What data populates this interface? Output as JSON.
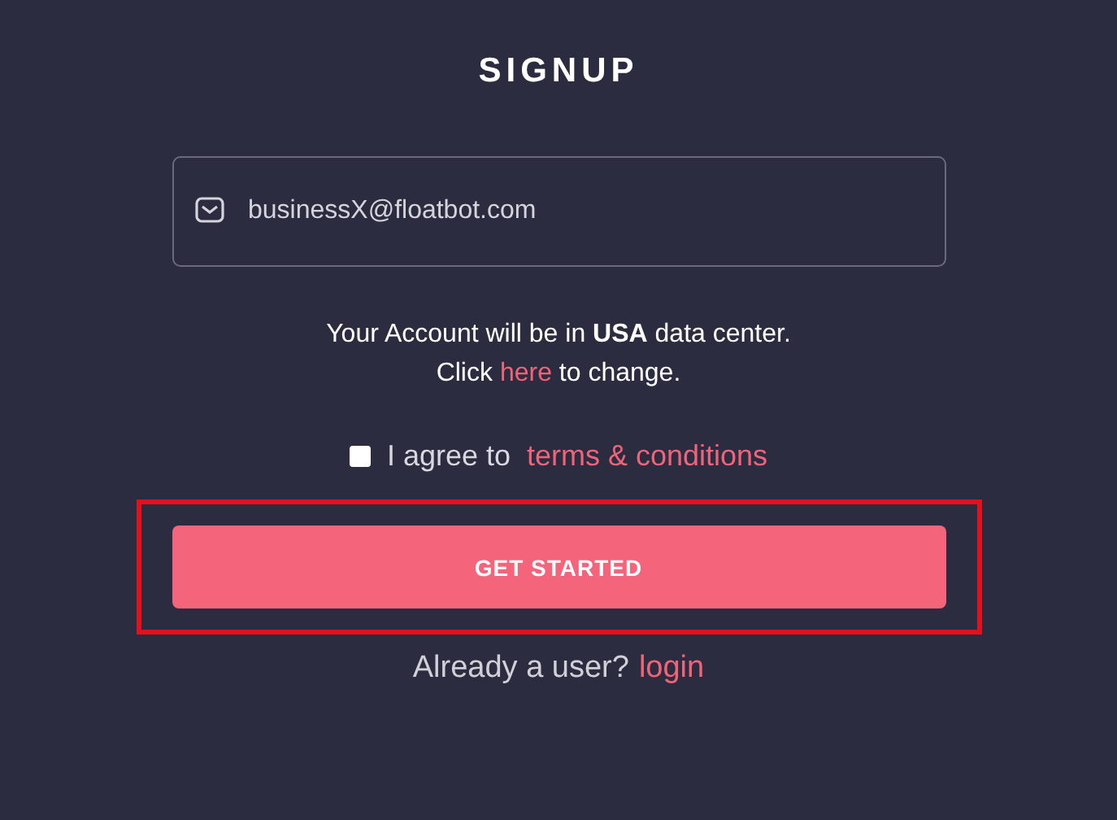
{
  "title": "SIGNUP",
  "email_field": {
    "value": "businessX@floatbot.com"
  },
  "data_center_note": {
    "line_1": "Your Account will be in **USA** data center.",
    "line_2_before": "Click",
    "link": "here",
    "line_2_after": "to change."
  },
  "terms": {
    "checked": false,
    "label": "I agree to",
    "link": "terms & conditions"
  },
  "submit_button": {
    "label": "GET STARTED",
    "highlighted": true
  },
  "login_prompt": {
    "text": "Already a user?",
    "link": "login"
  }
}
